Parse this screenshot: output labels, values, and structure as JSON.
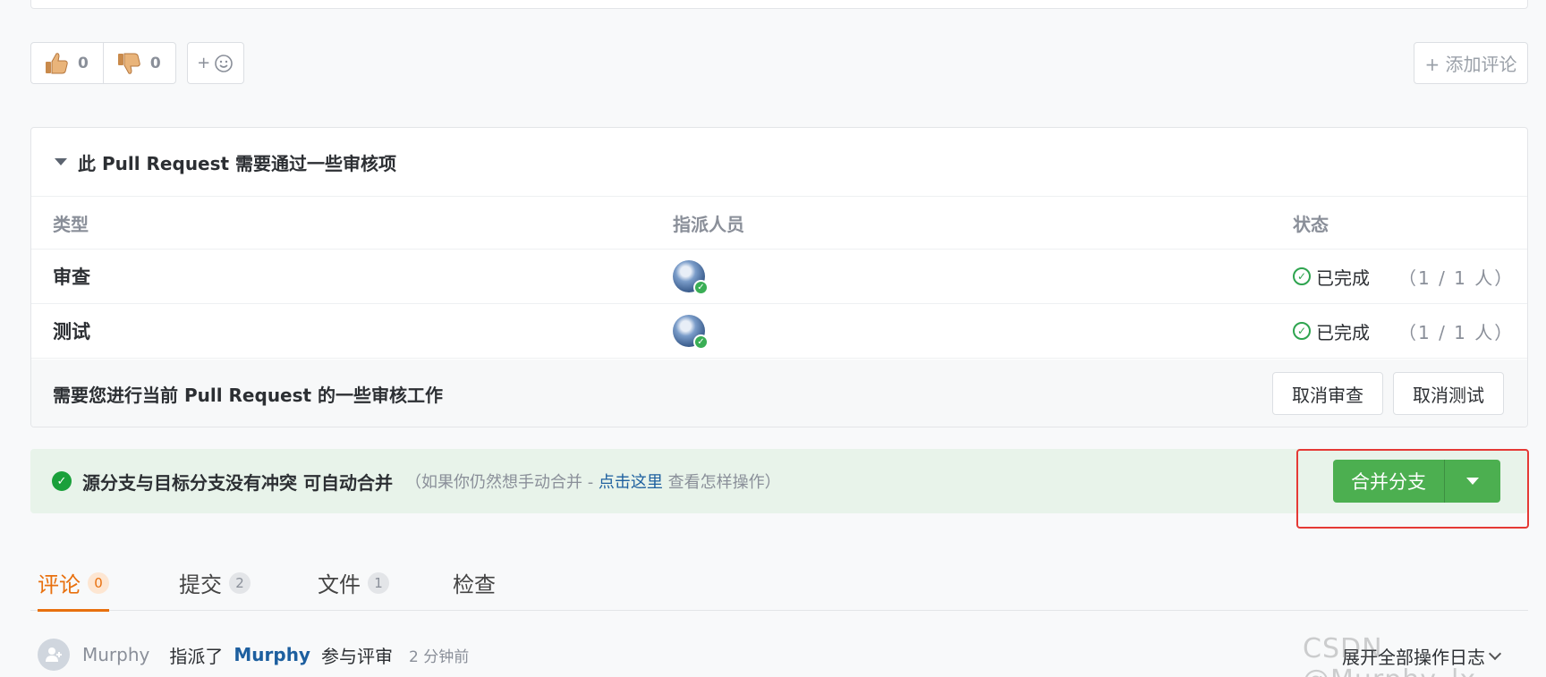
{
  "reactions": {
    "thumbs_up_count": "0",
    "thumbs_down_count": "0",
    "add_emoji_label": "+"
  },
  "add_comment_label": "+ 添加评论",
  "review_panel": {
    "title": "此 Pull Request 需要通过一些审核项",
    "columns": [
      "类型",
      "指派人员",
      "状态"
    ],
    "rows": [
      {
        "type": "审查",
        "status": "已完成",
        "count": "（1 / 1 人）"
      },
      {
        "type": "测试",
        "status": "已完成",
        "count": "（1 / 1 人）"
      }
    ],
    "footer_text": "需要您进行当前 Pull Request 的一些审核工作",
    "cancel_review_label": "取消审查",
    "cancel_test_label": "取消测试"
  },
  "merge": {
    "title": "源分支与目标分支没有冲突 可自动合并",
    "hint_prefix": "（如果你仍然想手动合并 - ",
    "hint_link": "点击这里",
    "hint_suffix": " 查看怎样操作）",
    "button_label": "合并分支",
    "accent_color": "#4caf50"
  },
  "tabs": [
    {
      "label": "评论",
      "count": "0"
    },
    {
      "label": "提交",
      "count": "2"
    },
    {
      "label": "文件",
      "count": "1"
    },
    {
      "label": "检查",
      "count": ""
    }
  ],
  "activity": {
    "user": "Murphy",
    "action": "指派了",
    "target": "Murphy",
    "action_suffix": "参与评审",
    "time": "2 分钟前",
    "expand_label": "展开全部操作日志"
  },
  "watermark": "CSDN @Murphy_lx",
  "colors": {
    "tab_active": "#e8700e",
    "success": "#2ea44f",
    "link": "#1d5f9f",
    "highlight_border": "#e53935"
  }
}
